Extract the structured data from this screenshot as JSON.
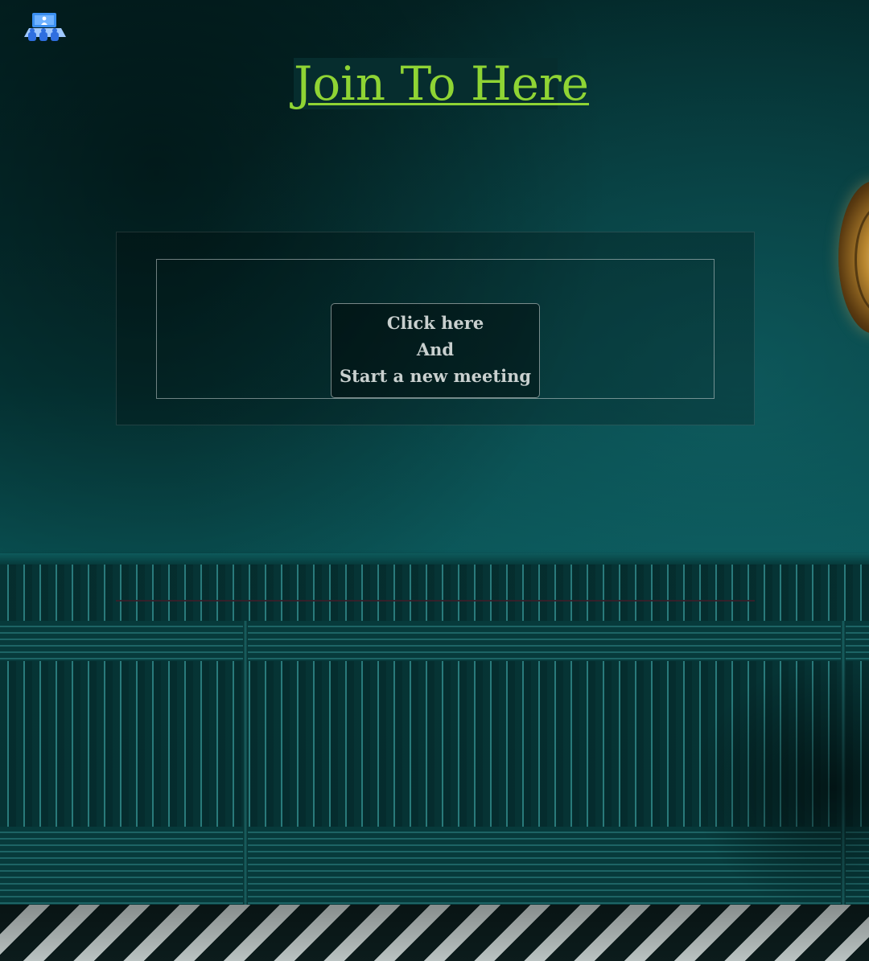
{
  "header": {
    "logo_icon": "meeting-people-icon",
    "title": "Join To Here"
  },
  "meeting_card": {
    "button_lines": [
      "Click here",
      "And",
      "Start a new meeting"
    ]
  },
  "colors": {
    "title": "#8fd434",
    "logo": "#3b8ff0",
    "button_text": "#c9d0cf",
    "wall": "#053c3d"
  }
}
